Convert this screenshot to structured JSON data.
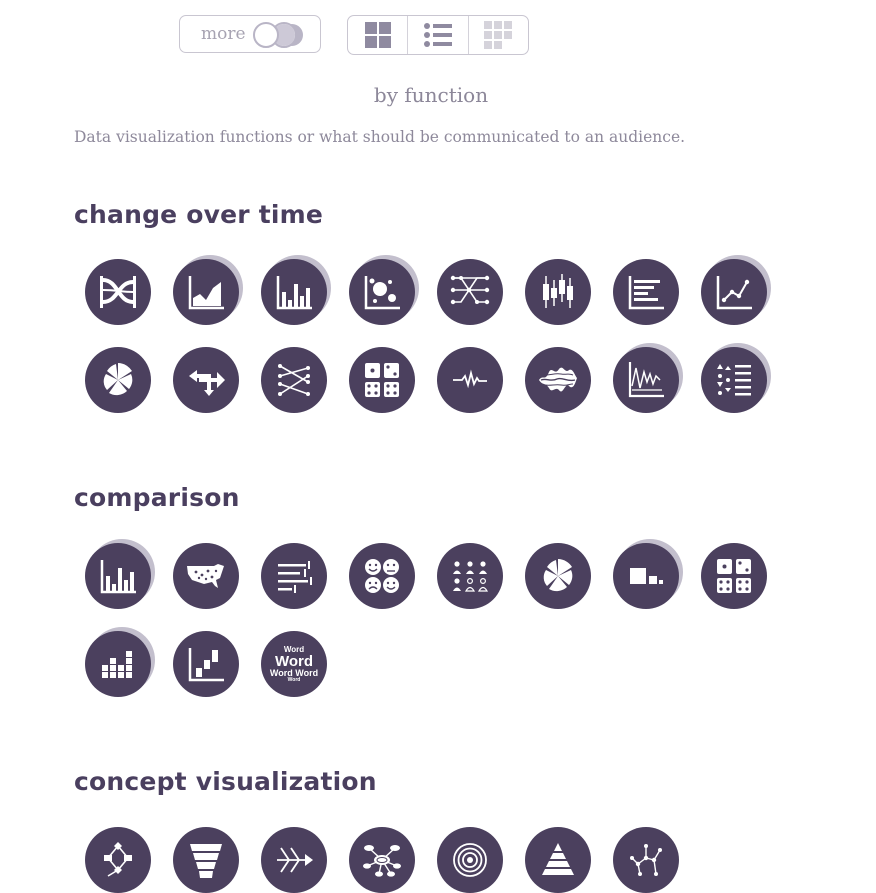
{
  "toolbar": {
    "more_label": "more",
    "views": [
      "grid-view",
      "list-view",
      "compact-grid-view"
    ]
  },
  "heading": "by function",
  "description": "Data visualization functions or what should be communicated to an audience.",
  "sections": [
    {
      "title": "change over time",
      "items": [
        {
          "icon": "alluvial-diagram-icon"
        },
        {
          "icon": "area-chart-icon"
        },
        {
          "icon": "bar-chart-icon"
        },
        {
          "icon": "bubble-chart-icon"
        },
        {
          "icon": "network-lines-icon"
        },
        {
          "icon": "candlestick-chart-icon"
        },
        {
          "icon": "gantt-chart-icon"
        },
        {
          "icon": "line-chart-icon"
        },
        {
          "icon": "radial-chart-icon"
        },
        {
          "icon": "flow-arrows-icon"
        },
        {
          "icon": "slope-chart-icon"
        },
        {
          "icon": "small-multiples-icon"
        },
        {
          "icon": "spiral-wave-icon"
        },
        {
          "icon": "stream-graph-icon"
        },
        {
          "icon": "stock-chart-icon"
        },
        {
          "icon": "timeline-list-icon"
        }
      ]
    },
    {
      "title": "comparison",
      "items": [
        {
          "icon": "bar-chart-icon"
        },
        {
          "icon": "choropleth-map-icon"
        },
        {
          "icon": "bullet-graph-icon"
        },
        {
          "icon": "chernoff-faces-icon"
        },
        {
          "icon": "pictograph-icon"
        },
        {
          "icon": "radial-chart-icon"
        },
        {
          "icon": "proportional-area-icon"
        },
        {
          "icon": "small-multiples-icon"
        },
        {
          "icon": "stacked-bar-grid-icon"
        },
        {
          "icon": "step-chart-icon"
        },
        {
          "icon": "word-cloud-icon",
          "words": [
            "Word",
            "Word",
            "Word Word",
            "Word"
          ]
        }
      ]
    },
    {
      "title": "concept visualization",
      "items": [
        {
          "icon": "flow-chart-icon"
        },
        {
          "icon": "funnel-icon"
        },
        {
          "icon": "fishbone-diagram-icon"
        },
        {
          "icon": "mind-map-icon"
        },
        {
          "icon": "target-circles-icon"
        },
        {
          "icon": "pyramid-icon"
        },
        {
          "icon": "tree-network-icon"
        }
      ]
    }
  ]
}
